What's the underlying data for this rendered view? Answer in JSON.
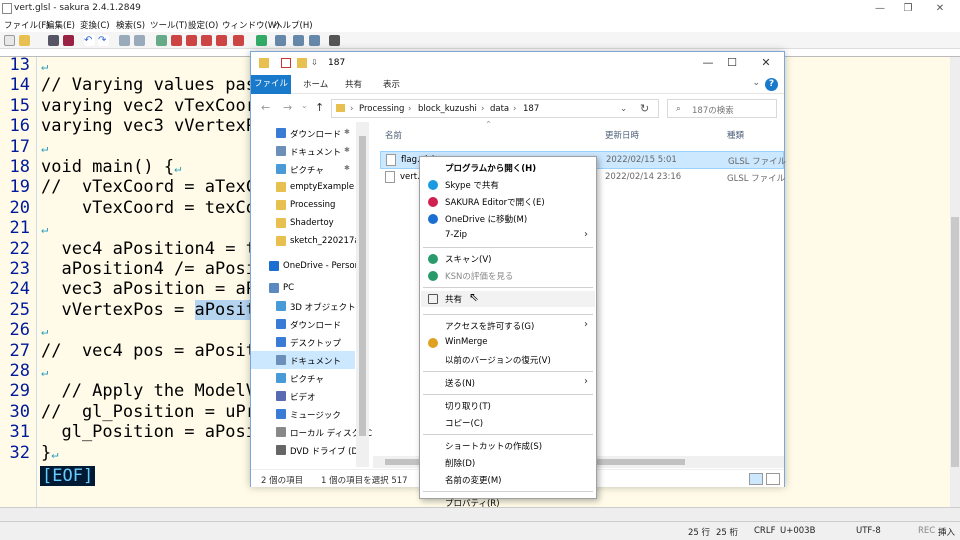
{
  "editor": {
    "title": "vert.glsl - sakura 2.4.1.2849",
    "menu": [
      "ファイル(F)",
      "編集(E)",
      "変換(C)",
      "検索(S)",
      "ツール(T)",
      "設定(O)",
      "ウィンドウ(W)",
      "ヘルプ(H)"
    ],
    "lines": [
      {
        "num": "13",
        "text": ""
      },
      {
        "num": "14",
        "text": "// Varying values pas"
      },
      {
        "num": "15",
        "text": "varying vec2 vTexCoor"
      },
      {
        "num": "16",
        "text": "varying vec3 vVertexP"
      },
      {
        "num": "17",
        "text": ""
      },
      {
        "num": "18",
        "text": "void main() {"
      },
      {
        "num": "19",
        "text": "//  vTexCoord = aTexC"
      },
      {
        "num": "20",
        "text": "    vTexCoord = texCo"
      },
      {
        "num": "21",
        "text": ""
      },
      {
        "num": "22",
        "text": "  vec4 aPosition4 = t"
      },
      {
        "num": "23",
        "text": "  aPosition4 /= aPosi"
      },
      {
        "num": "24",
        "text": "  vec3 aPosition = aP"
      },
      {
        "num": "25",
        "text": "  vVertexPos = ",
        "sel": "aPosit"
      },
      {
        "num": "26",
        "text": ""
      },
      {
        "num": "27",
        "text": "//  vec4 pos = aPosit"
      },
      {
        "num": "28",
        "text": ""
      },
      {
        "num": "29",
        "text": "  // Apply the ModelV"
      },
      {
        "num": "30",
        "text": "//  gl_Position = uPr"
      },
      {
        "num": "31",
        "text": "  gl_Position = aPosi"
      },
      {
        "num": "32",
        "text": "}"
      }
    ],
    "eof": "[EOF]",
    "return_mark": "↵",
    "status": {
      "row": "25 行",
      "col": "25 桁",
      "eol": "CRLF",
      "code": "U+003B",
      "enc": "UTF-8",
      "rec": "REC",
      "mode": "挿入"
    }
  },
  "explorer": {
    "title_path": "187",
    "tabs": {
      "file": "ファイル",
      "home": "ホーム",
      "share": "共有",
      "view": "表示"
    },
    "breadcrumb": [
      "Processing",
      "block_kuzushi",
      "data",
      "187"
    ],
    "search_placeholder": "187の検索",
    "nav_items": [
      {
        "label": "ダウンロード",
        "pin": true
      },
      {
        "label": "ドキュメント",
        "pin": true
      },
      {
        "label": "ピクチャ",
        "pin": true
      },
      {
        "label": "emptyExample"
      },
      {
        "label": "Processing"
      },
      {
        "label": "Shadertoy"
      },
      {
        "label": "sketch_220217a"
      },
      {
        "label": "OneDrive - Person"
      },
      {
        "label": "PC"
      },
      {
        "label": "3D オブジェクト"
      },
      {
        "label": "ダウンロード"
      },
      {
        "label": "デスクトップ"
      },
      {
        "label": "ドキュメント",
        "selected": true
      },
      {
        "label": "ピクチャ"
      },
      {
        "label": "ビデオ"
      },
      {
        "label": "ミュージック"
      },
      {
        "label": "ローカル ディスク (C"
      },
      {
        "label": "DVD ドライブ (D:)"
      }
    ],
    "columns": {
      "name": "名前",
      "date": "更新日時",
      "type": "種類"
    },
    "files": [
      {
        "name": "flag.glsl",
        "date": "2022/02/15 5:01",
        "type": "GLSL ファイル",
        "selected": true
      },
      {
        "name": "vert.g",
        "date": "2022/02/14 23:16",
        "type": "GLSL ファイル"
      }
    ],
    "status": {
      "count": "2 個の項目",
      "selected": "1 個の項目を選択 517"
    }
  },
  "context_menu": [
    {
      "label": "プログラムから開く(H)",
      "bold": true
    },
    {
      "label": "Skype で共有",
      "icon": "skype-icon",
      "color": "#1a9ae0"
    },
    {
      "label": "SAKURA Editorで開く(E)",
      "icon": "sakura-icon",
      "color": "#d02050"
    },
    {
      "label": "OneDrive に移動(M)",
      "icon": "onedrive-icon",
      "color": "#1a6fd0"
    },
    {
      "label": "7-Zip",
      "arrow": true
    },
    {
      "sep": true
    },
    {
      "label": "スキャン(V)",
      "icon": "kaspersky-shield-icon",
      "color": "#2a9a6a"
    },
    {
      "label": "KSNの評価を見る",
      "icon": "kaspersky-shield-icon",
      "color": "#2a9a6a",
      "disabled": true
    },
    {
      "sep": true
    },
    {
      "label": "共有",
      "icon": "share-icon",
      "color": "#555",
      "hover": true
    },
    {
      "sep": true
    },
    {
      "label": "アクセスを許可する(G)",
      "arrow": true
    },
    {
      "label": "WinMerge",
      "icon": "winmerge-icon",
      "color": "#e0a020"
    },
    {
      "label": "以前のバージョンの復元(V)"
    },
    {
      "sep": true
    },
    {
      "label": "送る(N)",
      "arrow": true
    },
    {
      "sep": true
    },
    {
      "label": "切り取り(T)"
    },
    {
      "label": "コピー(C)"
    },
    {
      "sep": true
    },
    {
      "label": "ショートカットの作成(S)"
    },
    {
      "label": "削除(D)"
    },
    {
      "label": "名前の変更(M)"
    },
    {
      "sep": true
    },
    {
      "label": "プロパティ(R)"
    }
  ]
}
